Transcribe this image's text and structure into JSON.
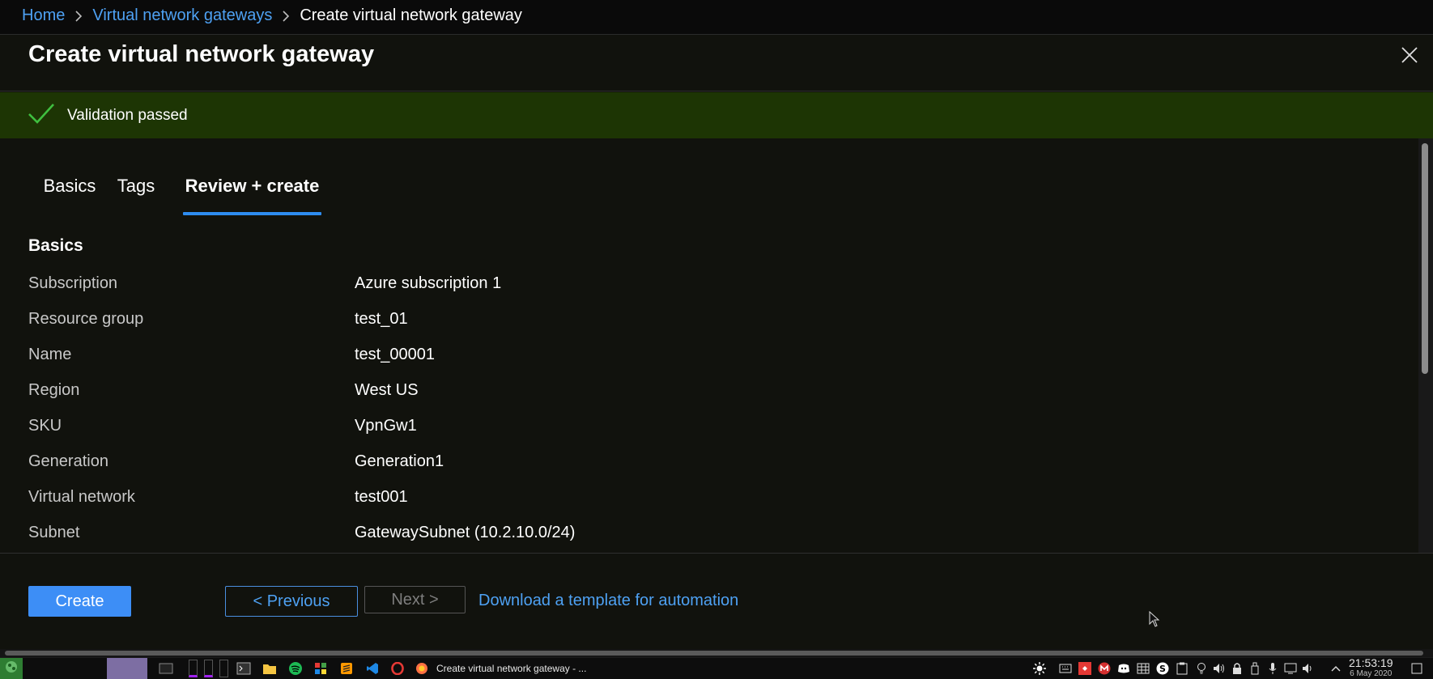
{
  "breadcrumb": {
    "items": [
      {
        "label": "Home",
        "link": true
      },
      {
        "label": "Virtual network gateways",
        "link": true
      },
      {
        "label": "Create virtual network gateway",
        "link": false
      }
    ]
  },
  "panel": {
    "title": "Create virtual network gateway"
  },
  "validation": {
    "message": "Validation passed",
    "color": "#1d3504"
  },
  "tabs": [
    {
      "label": "Basics",
      "active": false
    },
    {
      "label": "Tags",
      "active": false
    },
    {
      "label": "Review + create",
      "active": true
    }
  ],
  "review": {
    "section_title": "Basics",
    "rows": [
      {
        "label": "Subscription",
        "value": "Azure subscription 1"
      },
      {
        "label": "Resource group",
        "value": "test_01"
      },
      {
        "label": "Name",
        "value": "test_00001"
      },
      {
        "label": "Region",
        "value": "West US"
      },
      {
        "label": "SKU",
        "value": "VpnGw1"
      },
      {
        "label": "Generation",
        "value": "Generation1"
      },
      {
        "label": "Virtual network",
        "value": "test001"
      },
      {
        "label": "Subnet",
        "value": "GatewaySubnet (10.2.10.0/24)"
      }
    ]
  },
  "footer": {
    "create_label": "Create",
    "previous_label": "< Previous",
    "next_label": "Next >",
    "download_label": "Download a template for automation"
  },
  "taskbar": {
    "window_title": "Create virtual network gateway - ...",
    "time": "21:53:19",
    "date": "6 May 2020"
  },
  "theme": {
    "accent": "#3d8ef6",
    "link": "#4ea1f3",
    "panel_bg": "#11120d"
  }
}
